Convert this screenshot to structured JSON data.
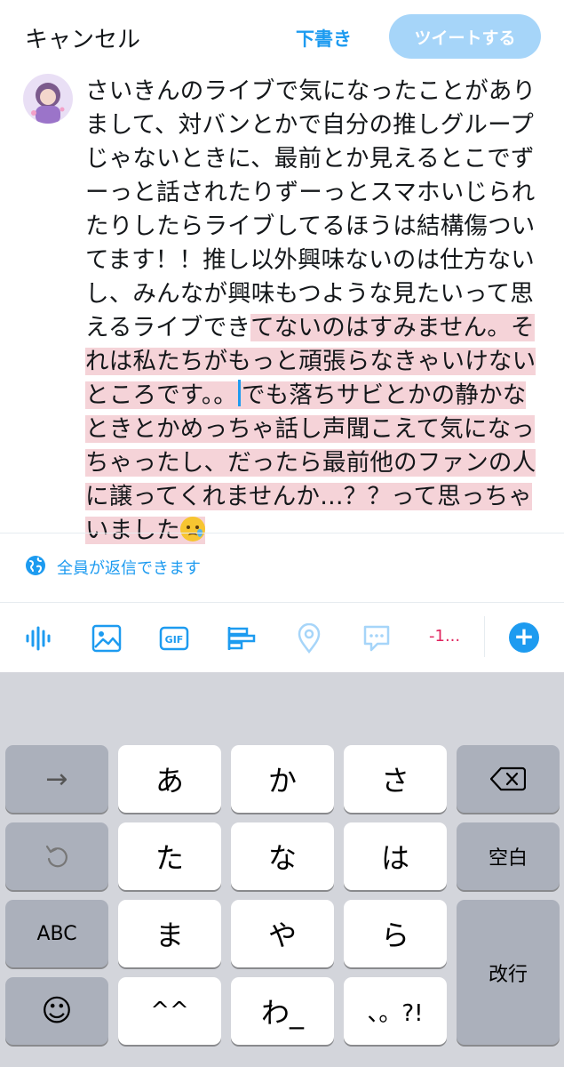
{
  "header": {
    "cancel_label": "キャンセル",
    "draft_label": "下書き",
    "tweet_label": "ツイートする"
  },
  "composer": {
    "text_before_highlight": "さいきんのライブで気になったことがありまして、対バンとかで自分の推しグループじゃないときに、最前とか見えるとこでずーっと話されたりずーっとスマホいじられたりしたらライブしてるほうは結構傷ついてます！！推し以外興味ないのは仕方ないし、みんなが興味もつような見たいって思えるライブでき",
    "text_highlight_before_cursor": "てないのはすみません。それは私たちがもっと頑張らなきゃいけないところです。。",
    "text_highlight_after_cursor": "でも落ちサビとかの静かなときとかめっちゃ話し声聞こえて気になっちゃったし、だったら最前他のファンの人に譲ってくれませんか…？？って思っちゃいました",
    "trailing_emoji": "face-holding-back-tears-icon"
  },
  "reply_setting": {
    "label": "全員が返信できます",
    "icon": "globe-icon"
  },
  "toolbar": {
    "items": [
      "audio-space-icon",
      "image-icon",
      "gif-icon",
      "poll-icon",
      "location-icon",
      "thread-icon"
    ],
    "gif_text": "GIF",
    "char_count": "-1...",
    "add_label": "+"
  },
  "keyboard": {
    "rows": [
      [
        "→",
        "あ",
        "か",
        "さ",
        "⌫"
      ],
      [
        "↺",
        "た",
        "な",
        "は",
        "空白"
      ],
      [
        "ABC",
        "ま",
        "や",
        "ら",
        "改行"
      ],
      [
        "☺",
        "^^",
        "わ_",
        "、。?!"
      ]
    ]
  },
  "colors": {
    "accent": "#1d9bf0",
    "tweet_button_disabled": "#a6d5f9",
    "highlight": "#f5d3d8",
    "count_over": "#e0245e",
    "keyboard_bg": "#d3d5db"
  }
}
